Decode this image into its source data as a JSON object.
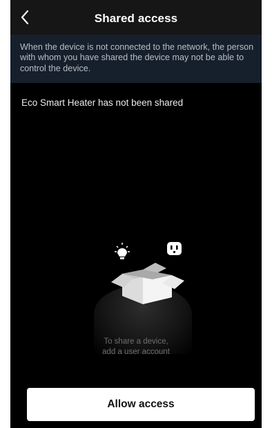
{
  "header": {
    "title": "Shared access",
    "back_icon": "chevron-left-icon"
  },
  "notice": {
    "text": "When the device is not connected to the network, the person with whom you have shared the device may not be able to control the device."
  },
  "status": {
    "text": "Eco Smart Heater has not been shared"
  },
  "empty_state": {
    "illustration_icons": [
      "bulb-icon",
      "socket-icon",
      "open-box-icon"
    ],
    "line1": "To share a device,",
    "line2": "add a user account"
  },
  "actions": {
    "allow_label": "Allow access"
  },
  "colors": {
    "background": "#000000",
    "header": "#161616",
    "notice_bg": "#16202c",
    "button_bg": "#ffffff"
  }
}
